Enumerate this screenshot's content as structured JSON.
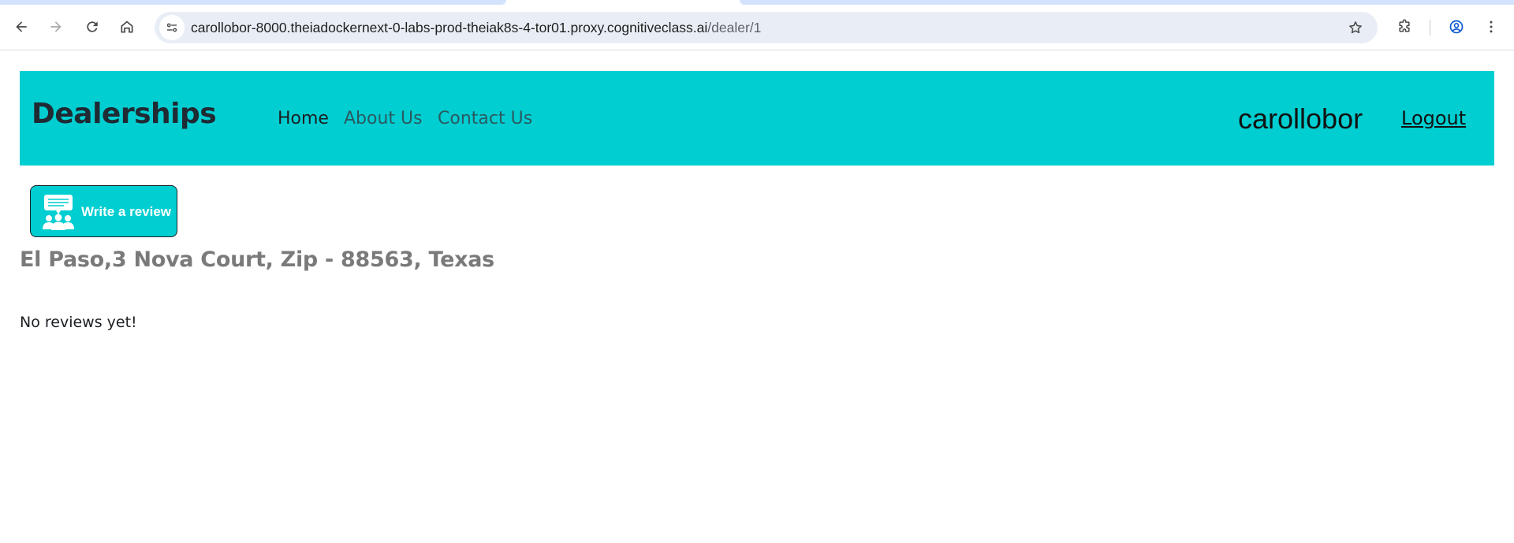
{
  "browser": {
    "url_host": "carollobor-8000.theiadockernext-0-labs-prod-theiak8s-4-tor01.proxy.cognitiveclass.ai",
    "url_path": "/dealer/1",
    "icons": {
      "back": "arrow-left-icon",
      "forward": "arrow-right-icon",
      "reload": "reload-icon",
      "home": "home-icon",
      "site_info": "tune-icon",
      "bookmark": "star-icon",
      "extensions": "puzzle-icon",
      "profile": "account-circle-icon",
      "menu": "kebab-menu-icon"
    },
    "colors": {
      "tab_strip": "#d3e3fd",
      "omnibox_bg": "#e9eef6",
      "profile_accent": "#0b57d0"
    }
  },
  "header": {
    "brand": "Dealerships",
    "nav": {
      "home": "Home",
      "about": "About Us",
      "contact": "Contact Us"
    },
    "username": "carollobor",
    "logout": "Logout",
    "background_color": "#00ced1"
  },
  "dealer": {
    "review_button": {
      "label": "Write a review",
      "icon": "review-people-icon"
    },
    "address": "El Paso,3 Nova Court, Zip - 88563, Texas",
    "reviews_status": "No reviews yet!"
  }
}
